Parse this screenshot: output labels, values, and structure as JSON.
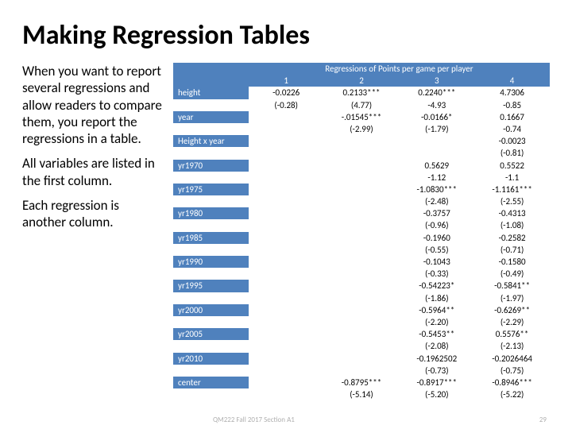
{
  "title": "Making Regression Tables",
  "paragraphs": {
    "p1": "When you want to report several regressions and allow readers to compare them, you report the regressions in a table.",
    "p2": "All variables are listed in the first column.",
    "p3": "Each regression is another column."
  },
  "table": {
    "header": "Regressions of Points per game per player",
    "cols": {
      "c1": "1",
      "c2": "2",
      "c3": "3",
      "c4": "4"
    },
    "rows": [
      {
        "label": "height",
        "c1": "-0.0226",
        "c2": "0.2133***",
        "c3": "0.2240***",
        "c4": "4.7306"
      },
      {
        "label": "",
        "c1": "(-0.28)",
        "c2": "(4.77)",
        "c3": "-4.93",
        "c4": "-0.85"
      },
      {
        "label": "year",
        "c1": "",
        "c2": "-.01545***",
        "c3": "-0.0166*",
        "c4": "0.1667"
      },
      {
        "label": "",
        "c1": "",
        "c2": "(-2.99)",
        "c3": "(-1.79)",
        "c4": "-0.74"
      },
      {
        "label": "Height x year",
        "c1": "",
        "c2": "",
        "c3": "",
        "c4": "-0.0023"
      },
      {
        "label": "",
        "c1": "",
        "c2": "",
        "c3": "",
        "c4": "(-0.81)"
      },
      {
        "label": "yr1970",
        "c1": "",
        "c2": "",
        "c3": "0.5629",
        "c4": "0.5522"
      },
      {
        "label": "",
        "c1": "",
        "c2": "",
        "c3": "-1.12",
        "c4": "-1.1"
      },
      {
        "label": "yr1975",
        "c1": "",
        "c2": "",
        "c3": "-1.0830***",
        "c4": "-1.1161***"
      },
      {
        "label": "",
        "c1": "",
        "c2": "",
        "c3": "(-2.48)",
        "c4": "(-2.55)"
      },
      {
        "label": "yr1980",
        "c1": "",
        "c2": "",
        "c3": "-0.3757",
        "c4": "-0.4313"
      },
      {
        "label": "",
        "c1": "",
        "c2": "",
        "c3": "(-0.96)",
        "c4": "(-1.08)"
      },
      {
        "label": "yr1985",
        "c1": "",
        "c2": "",
        "c3": "-0.1960",
        "c4": "-0.2582"
      },
      {
        "label": "",
        "c1": "",
        "c2": "",
        "c3": "(-0.55)",
        "c4": "(-0.71)"
      },
      {
        "label": "yr1990",
        "c1": "",
        "c2": "",
        "c3": "-0.1043",
        "c4": "-0.1580"
      },
      {
        "label": "",
        "c1": "",
        "c2": "",
        "c3": "(-0.33)",
        "c4": "(-0.49)"
      },
      {
        "label": "yr1995",
        "c1": "",
        "c2": "",
        "c3": "-0.54223*",
        "c4": "-0.5841**"
      },
      {
        "label": "",
        "c1": "",
        "c2": "",
        "c3": "(-1.86)",
        "c4": "(-1.97)"
      },
      {
        "label": "yr2000",
        "c1": "",
        "c2": "",
        "c3": "-0.5964**",
        "c4": "-0.6269**"
      },
      {
        "label": "",
        "c1": "",
        "c2": "",
        "c3": "(-2.20)",
        "c4": "(-2.29)"
      },
      {
        "label": "yr2005",
        "c1": "",
        "c2": "",
        "c3": "-0.5453**",
        "c4": "0.5576**"
      },
      {
        "label": "",
        "c1": "",
        "c2": "",
        "c3": "(-2.08)",
        "c4": "(-2.13)"
      },
      {
        "label": "yr2010",
        "c1": "",
        "c2": "",
        "c3": "-0.1962502",
        "c4": "-0.2026464"
      },
      {
        "label": "",
        "c1": "",
        "c2": "",
        "c3": "(-0.73)",
        "c4": "(-0.75)"
      },
      {
        "label": "center",
        "c1": "",
        "c2": "-0.8795***",
        "c3": "-0.8917***",
        "c4": "-0.8946***"
      },
      {
        "label": "",
        "c1": "",
        "c2": "(-5.14)",
        "c3": "(-5.20)",
        "c4": "(-5.22)"
      }
    ]
  },
  "footer": {
    "text": "QM222 Fall 2017 Section A1",
    "page": "29"
  },
  "chart_data": {
    "type": "table",
    "title": "Regressions of Points per game per player",
    "columns": [
      "1",
      "2",
      "3",
      "4"
    ],
    "variables": [
      "height",
      "year",
      "Height x year",
      "yr1970",
      "yr1975",
      "yr1980",
      "yr1985",
      "yr1990",
      "yr1995",
      "yr2000",
      "yr2005",
      "yr2010",
      "center"
    ],
    "coefficients": {
      "height": {
        "1": -0.0226,
        "2": 0.2133,
        "3": 0.224,
        "4": 4.7306
      },
      "year": {
        "2": -0.01545,
        "3": -0.0166,
        "4": 0.1667
      },
      "Height x year": {
        "4": -0.0023
      },
      "yr1970": {
        "3": 0.5629,
        "4": 0.5522
      },
      "yr1975": {
        "3": -1.083,
        "4": -1.1161
      },
      "yr1980": {
        "3": -0.3757,
        "4": -0.4313
      },
      "yr1985": {
        "3": -0.196,
        "4": -0.2582
      },
      "yr1990": {
        "3": -0.1043,
        "4": -0.158
      },
      "yr1995": {
        "3": -0.54223,
        "4": -0.5841
      },
      "yr2000": {
        "3": -0.5964,
        "4": -0.6269
      },
      "yr2005": {
        "3": -0.5453,
        "4": 0.5576
      },
      "yr2010": {
        "3": -0.1962502,
        "4": -0.2026464
      },
      "center": {
        "2": -0.8795,
        "3": -0.8917,
        "4": -0.8946
      }
    },
    "tstats": {
      "height": {
        "1": -0.28,
        "2": 4.77,
        "3": -4.93,
        "4": -0.85
      },
      "year": {
        "2": -2.99,
        "3": -1.79,
        "4": -0.74
      },
      "Height x year": {
        "4": -0.81
      },
      "yr1970": {
        "3": -1.12,
        "4": -1.1
      },
      "yr1975": {
        "3": -2.48,
        "4": -2.55
      },
      "yr1980": {
        "3": -0.96,
        "4": -1.08
      },
      "yr1985": {
        "3": -0.55,
        "4": -0.71
      },
      "yr1990": {
        "3": -0.33,
        "4": -0.49
      },
      "yr1995": {
        "3": -1.86,
        "4": -1.97
      },
      "yr2000": {
        "3": -2.2,
        "4": -2.29
      },
      "yr2005": {
        "3": -2.08,
        "4": -2.13
      },
      "yr2010": {
        "3": -0.73,
        "4": -0.75
      },
      "center": {
        "2": -5.14,
        "3": -5.2,
        "4": -5.22
      }
    }
  }
}
